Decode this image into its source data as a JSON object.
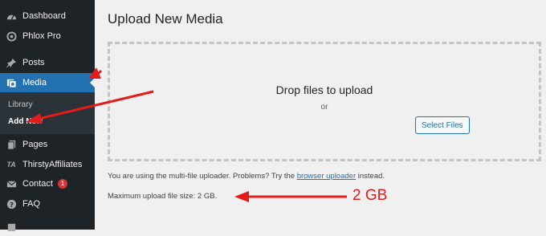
{
  "sidebar": {
    "items": [
      {
        "label": "Dashboard",
        "icon": "dashboard-icon"
      },
      {
        "label": "Phlox Pro",
        "icon": "phlox-icon"
      },
      {
        "label": "Posts",
        "icon": "pin-icon"
      },
      {
        "label": "Media",
        "icon": "media-icon"
      },
      {
        "label": "Pages",
        "icon": "pages-icon"
      },
      {
        "label": "ThirstyAffiliates",
        "icon": "ta-icon"
      },
      {
        "label": "Contact",
        "icon": "mail-icon",
        "badge": "1"
      },
      {
        "label": "FAQ",
        "icon": "help-icon"
      }
    ],
    "submenu": {
      "library": "Library",
      "add_new": "Add New"
    },
    "ta_icon_text": "TA",
    "active_color": "#2271b1",
    "background_color": "#1d2327"
  },
  "main": {
    "title": "Upload New Media",
    "dropzone": {
      "drop_text": "Drop files to upload",
      "or_text": "or",
      "select_button": "Select Files"
    },
    "uploader_note": {
      "prefix": "You are using the multi-file uploader. Problems? Try the ",
      "link": "browser uploader",
      "suffix": " instead."
    },
    "max_size": "Maximum upload file size: 2 GB."
  },
  "annotations": {
    "gb_label": "2 GB",
    "arrow_color": "#e31b1b"
  }
}
